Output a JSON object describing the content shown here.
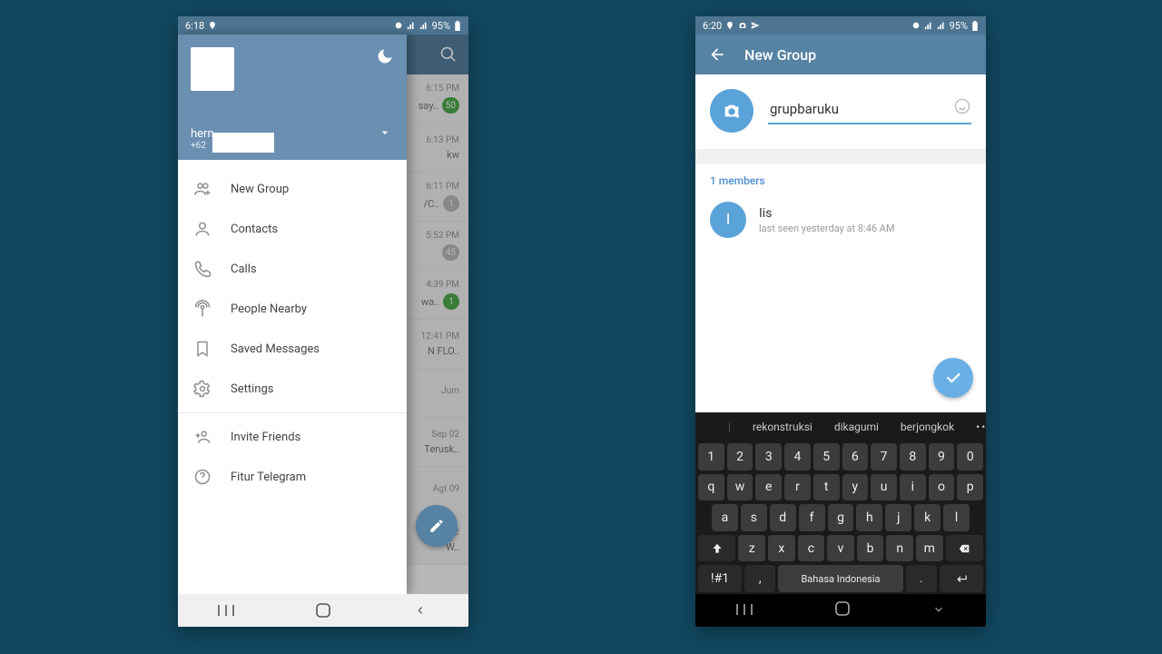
{
  "left": {
    "status": {
      "time": "6:18",
      "battery": "95%"
    },
    "drawer": {
      "username": "hern",
      "phone": "+62",
      "menu": [
        {
          "icon": "group-add",
          "label": "New Group"
        },
        {
          "icon": "contact",
          "label": "Contacts"
        },
        {
          "icon": "call",
          "label": "Calls"
        },
        {
          "icon": "nearby",
          "label": "People Nearby"
        },
        {
          "icon": "bookmark",
          "label": "Saved Messages"
        },
        {
          "icon": "gear",
          "label": "Settings"
        },
        {
          "divider": true
        },
        {
          "icon": "invite",
          "label": "Invite Friends"
        },
        {
          "icon": "help",
          "label": "Fitur Telegram"
        }
      ]
    },
    "chats": [
      {
        "time": "6:15 PM",
        "preview": "say..",
        "badge": "50",
        "green": true
      },
      {
        "time": "6:13 PM",
        "preview": "kw",
        "badge": "",
        "green": false
      },
      {
        "time": "6:11 PM",
        "preview": "/C..",
        "badge": "1",
        "green": false
      },
      {
        "time": "5:52 PM",
        "preview": "",
        "badge": "45",
        "green": false
      },
      {
        "time": "4:39 PM",
        "preview": "wa..",
        "badge": "1",
        "green": true
      },
      {
        "time": "12:41 PM",
        "preview": "N FLO..",
        "badge": "",
        "green": false
      },
      {
        "time": "Jum",
        "preview": "",
        "badge": "",
        "green": false
      },
      {
        "time": "Sep 02",
        "preview": "Terusk..",
        "badge": "",
        "green": false
      },
      {
        "time": "Agt 09",
        "preview": "",
        "badge": "",
        "green": false
      },
      {
        "time": "Agt 02",
        "preview": "W..",
        "badge": "",
        "green": false
      }
    ]
  },
  "right": {
    "status": {
      "time": "6:20",
      "battery": "95%"
    },
    "title": "New Group",
    "group_name_value": "grupbaruku",
    "members_label": "1 members",
    "member": {
      "initial": "I",
      "name": "Iis",
      "seen": "last seen yesterday at 8:46 AM"
    },
    "suggestions": [
      "rekonstruksi",
      "dikagumi",
      "berjongkok"
    ],
    "keyboard": {
      "row1": [
        "1",
        "2",
        "3",
        "4",
        "5",
        "6",
        "7",
        "8",
        "9",
        "0"
      ],
      "row2": [
        "q",
        "w",
        "e",
        "r",
        "t",
        "y",
        "u",
        "i",
        "o",
        "p"
      ],
      "row3": [
        "a",
        "s",
        "d",
        "f",
        "g",
        "h",
        "j",
        "k",
        "l"
      ],
      "row4": [
        "z",
        "x",
        "c",
        "v",
        "b",
        "n",
        "m"
      ],
      "space_label": "Bahasa Indonesia",
      "sym": "!#1"
    }
  }
}
